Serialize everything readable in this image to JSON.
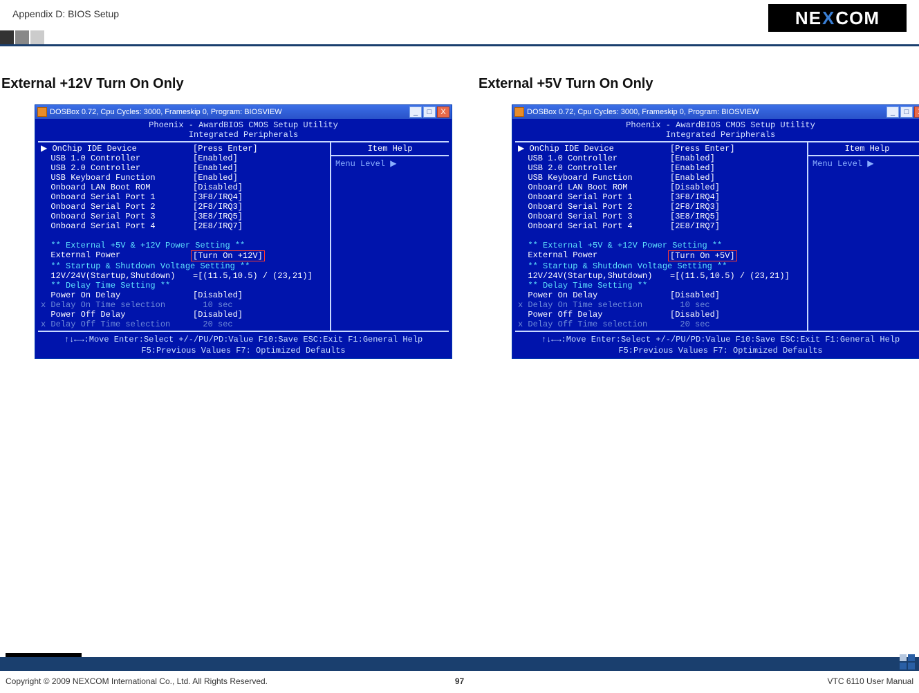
{
  "header": {
    "breadcrumb": "Appendix D: BIOS Setup",
    "logo_text_left": "NE",
    "logo_text_mid": "X",
    "logo_text_right": "COM"
  },
  "left": {
    "title": "External +12V Turn On Only",
    "window_title": "DOSBox 0.72, Cpu Cycles:    3000, Frameskip  0, Program: BIOSVIEW",
    "bios_title1": "Phoenix - AwardBIOS CMOS Setup Utility",
    "bios_title2": "Integrated Peripherals",
    "help_title": "Item Help",
    "menu_level": "Menu Level   ▶",
    "rows": [
      {
        "label": "OnChip IDE Device",
        "val": "[Press Enter]",
        "arrow": true
      },
      {
        "label": "USB 1.0 Controller",
        "val": "[Enabled]"
      },
      {
        "label": "USB 2.0 Controller",
        "val": "[Enabled]"
      },
      {
        "label": "USB Keyboard Function",
        "val": "[Enabled]"
      },
      {
        "label": "Onboard LAN Boot ROM",
        "val": "[Disabled]"
      },
      {
        "label": "Onboard Serial Port 1",
        "val": "[3F8/IRQ4]"
      },
      {
        "label": "Onboard Serial Port 2",
        "val": "[2F8/IRQ3]"
      },
      {
        "label": "Onboard Serial Port 3",
        "val": "[3E8/IRQ5]"
      },
      {
        "label": "Onboard Serial Port 4",
        "val": "[2E8/IRQ7]"
      }
    ],
    "section1": "** External +5V & +12V Power Setting **",
    "ext_power_label": "External Power",
    "ext_power_val": "[Turn On +12V]",
    "section2": "** Startup & Shutdown Voltage Setting **",
    "voltage_label": "12V/24V(Startup,Shutdown)",
    "voltage_val": "=[(11.5,10.5) / (23,21)]",
    "section3": "** Delay Time Setting **",
    "pod_label": "Power On Delay",
    "pod_val": "[Disabled]",
    "dot_label": "Delay On Time selection",
    "dot_val": "  10 sec",
    "poff_label": "Power Off Delay",
    "poff_val": "[Disabled]",
    "doff_label": "Delay Off Time selection",
    "doff_val": "  20 sec",
    "footer1": "↑↓←→:Move  Enter:Select  +/-/PU/PD:Value  F10:Save  ESC:Exit  F1:General Help",
    "footer2": "F5:Previous Values                    F7: Optimized Defaults"
  },
  "right": {
    "title": "External +5V Turn On Only",
    "window_title": "DOSBox 0.72, Cpu Cycles:    3000, Frameskip  0, Program: BIOSVIEW",
    "bios_title1": "Phoenix - AwardBIOS CMOS Setup Utility",
    "bios_title2": "Integrated Peripherals",
    "help_title": "Item Help",
    "menu_level": "Menu Level   ▶",
    "rows": [
      {
        "label": "OnChip IDE Device",
        "val": "[Press Enter]",
        "arrow": true
      },
      {
        "label": "USB 1.0 Controller",
        "val": "[Enabled]"
      },
      {
        "label": "USB 2.0 Controller",
        "val": "[Enabled]"
      },
      {
        "label": "USB Keyboard Function",
        "val": "[Enabled]"
      },
      {
        "label": "Onboard LAN Boot ROM",
        "val": "[Disabled]"
      },
      {
        "label": "Onboard Serial Port 1",
        "val": "[3F8/IRQ4]"
      },
      {
        "label": "Onboard Serial Port 2",
        "val": "[2F8/IRQ3]"
      },
      {
        "label": "Onboard Serial Port 3",
        "val": "[3E8/IRQ5]"
      },
      {
        "label": "Onboard Serial Port 4",
        "val": "[2E8/IRQ7]"
      }
    ],
    "section1": "** External +5V & +12V Power Setting **",
    "ext_power_label": "External Power",
    "ext_power_val": "[Turn On +5V]",
    "section2": "** Startup & Shutdown Voltage Setting **",
    "voltage_label": "12V/24V(Startup,Shutdown)",
    "voltage_val": "=[(11.5,10.5) / (23,21)]",
    "section3": "** Delay Time Setting **",
    "pod_label": "Power On Delay",
    "pod_val": "[Disabled]",
    "dot_label": "Delay On Time selection",
    "dot_val": "  10 sec",
    "poff_label": "Power Off Delay",
    "poff_val": "[Disabled]",
    "doff_label": "Delay Off Time selection",
    "doff_val": "  20 sec",
    "footer1": "↑↓←→:Move  Enter:Select  +/-/PU/PD:Value  F10:Save  ESC:Exit  F1:General Help",
    "footer2": "F5:Previous Values                    F7: Optimized Defaults"
  },
  "footer": {
    "copyright": "Copyright © 2009 NEXCOM International Co., Ltd. All Rights Reserved.",
    "page": "97",
    "manual": "VTC 6110 User Manual"
  }
}
